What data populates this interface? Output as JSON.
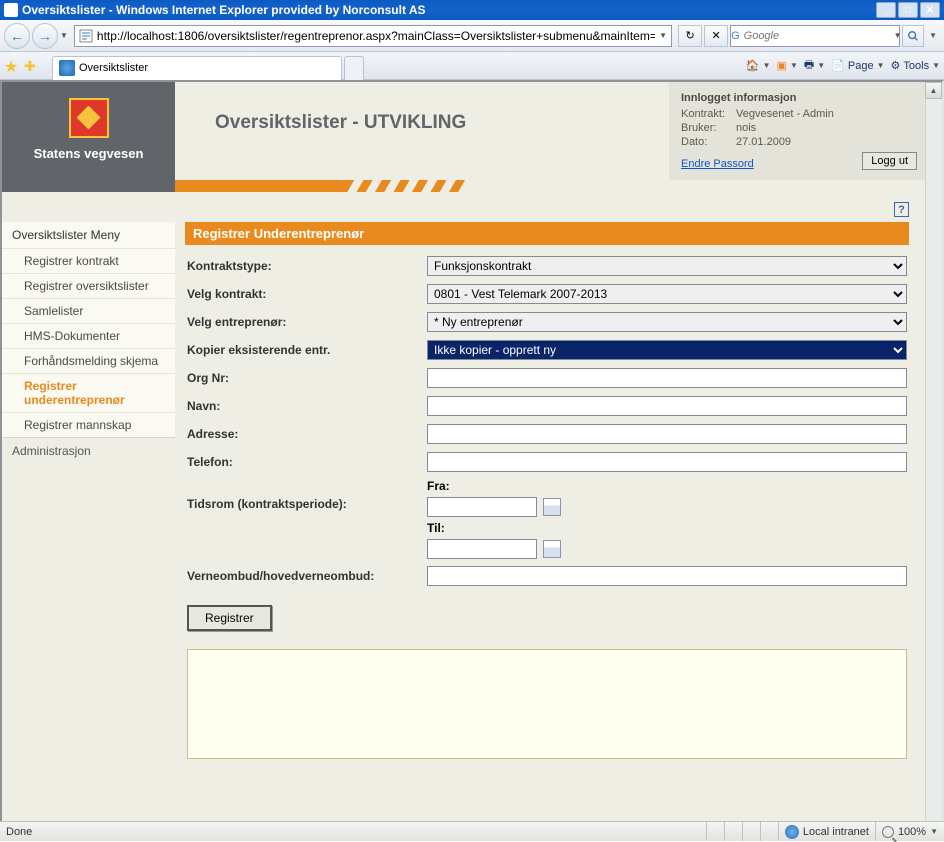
{
  "window": {
    "title": "Oversiktslister - Windows Internet Explorer provided by Norconsult AS"
  },
  "nav": {
    "url": "http://localhost:1806/oversiktslister/regentreprenor.aspx?mainClass=Oversiktslister+submenu&mainItem=r",
    "searchPlaceholder": "Google"
  },
  "tab": {
    "title": "Oversiktslister"
  },
  "toolbar": {
    "page": "Page",
    "tools": "Tools"
  },
  "logo": {
    "org": "Statens vegvesen"
  },
  "pageTitle": "Oversiktslister - UTVIKLING",
  "info": {
    "heading": "Innlogget informasjon",
    "labels": {
      "kontrakt": "Kontrakt:",
      "bruker": "Bruker:",
      "dato": "Dato:"
    },
    "kontrakt": "Vegvesenet - Admin",
    "bruker": "nois",
    "dato": "27.01.2009",
    "changePw": "Endre Passord",
    "logout": "Logg ut"
  },
  "sidebar": {
    "title": "Oversiktslister Meny",
    "items": [
      "Registrer kontrakt",
      "Registrer oversiktslister",
      "Samlelister",
      "HMS-Dokumenter",
      "Forhåndsmelding skjema",
      "Registrer underentreprenør",
      "Registrer mannskap"
    ],
    "admin": "Administrasjon"
  },
  "panel": {
    "title": "Registrer Underentreprenør",
    "labels": {
      "kontraktstype": "Kontraktstype:",
      "velgKontrakt": "Velg kontrakt:",
      "velgEntreprenor": "Velg entreprenør:",
      "kopier": "Kopier eksisterende entr.",
      "orgnr": "Org Nr:",
      "navn": "Navn:",
      "adresse": "Adresse:",
      "telefon": "Telefon:",
      "tidsrom": "Tidsrom (kontraktsperiode):",
      "fra": "Fra:",
      "til": "Til:",
      "verneombud": "Verneombud/hovedverneombud:"
    },
    "values": {
      "kontraktstype": "Funksjonskontrakt",
      "velgKontrakt": "0801 - Vest Telemark 2007-2013",
      "velgEntreprenor": "* Ny entreprenør",
      "kopier": "Ikke kopier - opprett ny"
    },
    "submit": "Registrer"
  },
  "status": {
    "done": "Done",
    "zone": "Local intranet",
    "zoom": "100%"
  }
}
